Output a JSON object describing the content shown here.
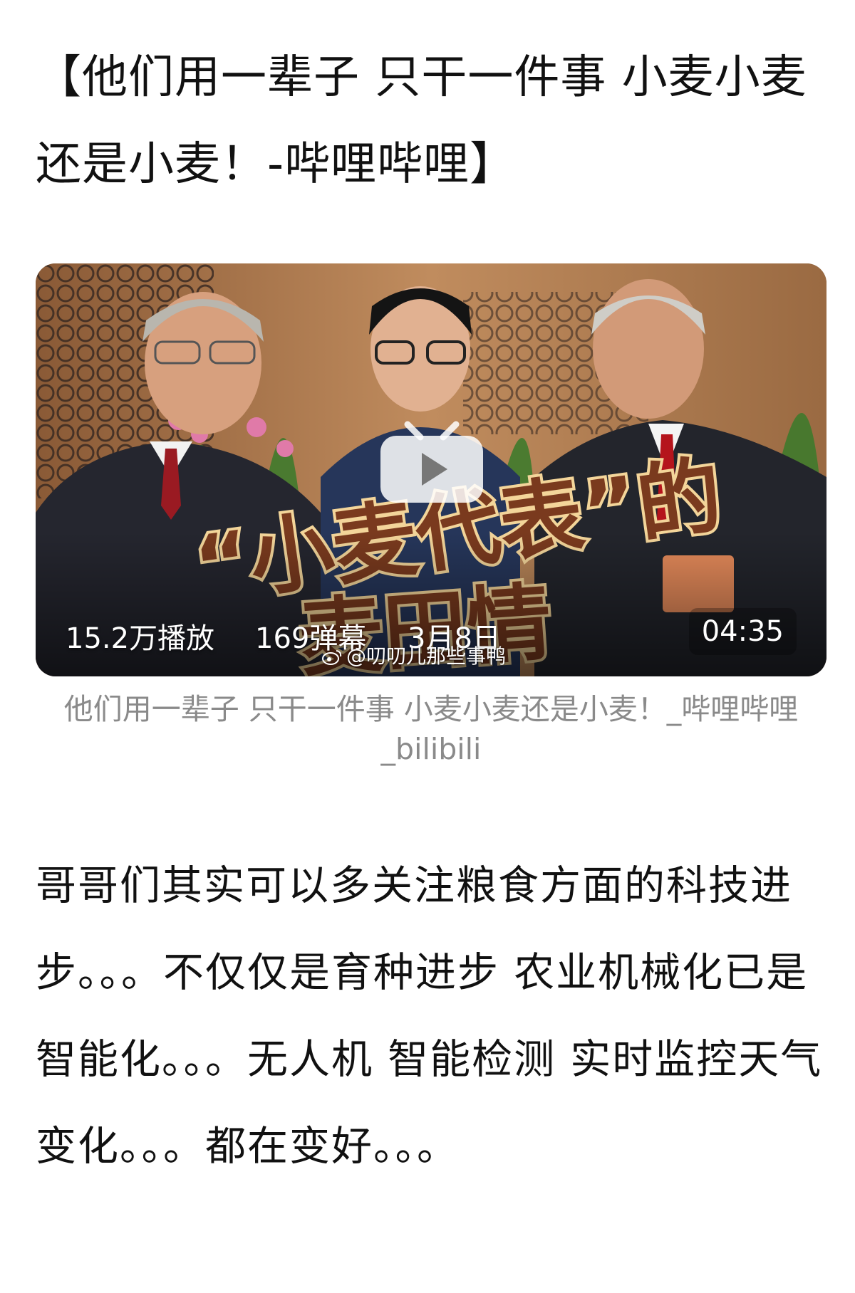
{
  "article": {
    "title": "【他们用一辈子 只干一件事 小麦小麦还是小麦！-哔哩哔哩】",
    "caption": "他们用一辈子 只干一件事 小麦小麦还是小麦！_哔哩哔哩_bilibili",
    "body": "哥哥们其实可以多关注粮食方面的科技进步。。。不仅仅是育种进步 农业机械化已是智能化。。。无人机 智能检测 实时监控天气变化。。。都在变好。。。"
  },
  "video": {
    "thumbnail_text": "“小麦代表”的麦田情",
    "views": "15.2万播放",
    "danmaku": "169弹幕",
    "date": "3月8日",
    "duration": "04:35",
    "play_icon": "bilibili-tv-play-icon"
  },
  "watermark": {
    "text": "@叨叨儿那些事鸭",
    "icon": "weibo-icon"
  },
  "colors": {
    "title_text": "#111111",
    "caption_text": "#8a8a8a",
    "overlay_text": "#ffffff",
    "thumbnail_bg": "#a8744a"
  }
}
